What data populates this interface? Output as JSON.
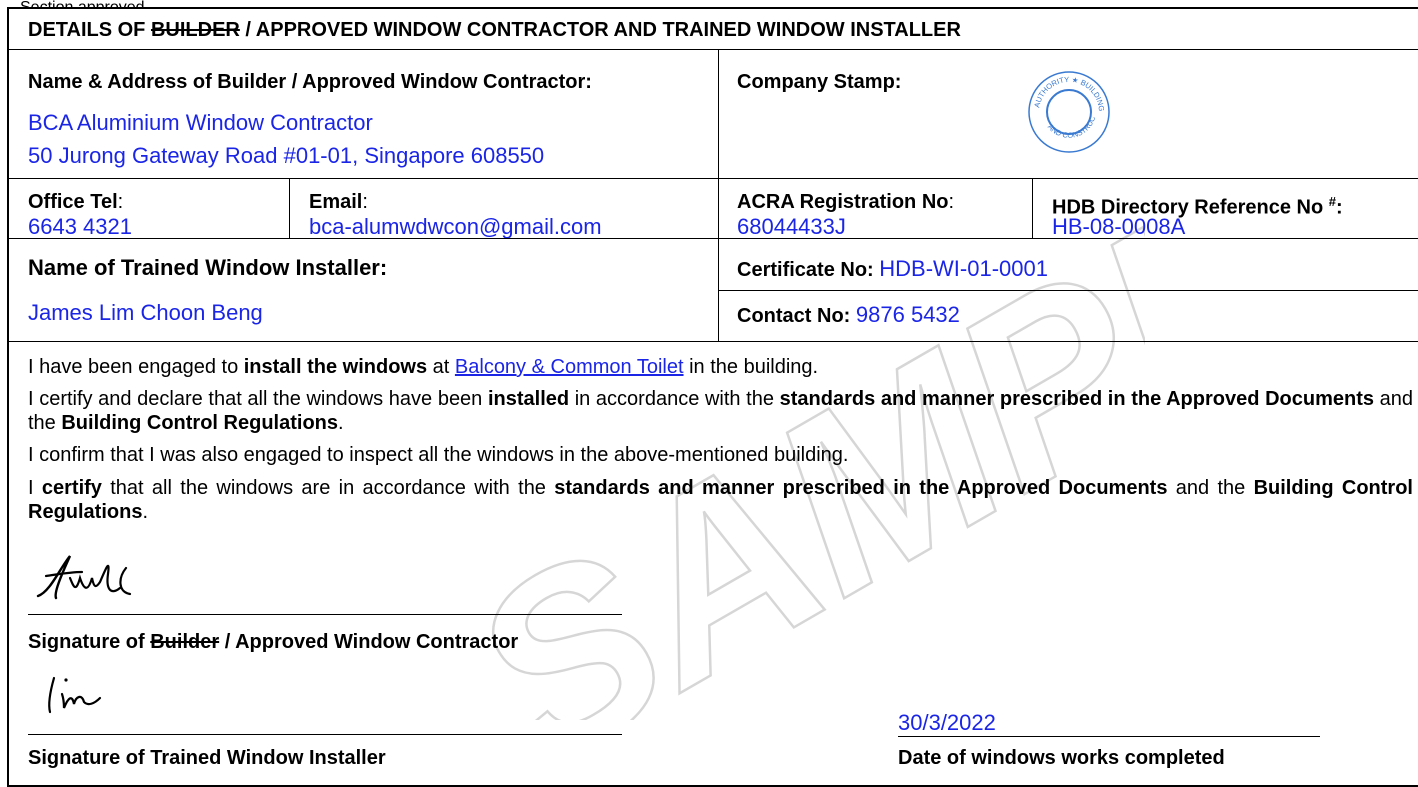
{
  "top_fragment": "Section approved",
  "header": {
    "prefix": "DETAILS OF ",
    "struck": "BUILDER",
    "suffix": " / APPROVED WINDOW CONTRACTOR AND TRAINED WINDOW INSTALLER"
  },
  "builder": {
    "label": "Name & Address of Builder / Approved Window Contractor:",
    "name": "BCA Aluminium Window Contractor",
    "address": "50 Jurong Gateway Road #01-01, Singapore 608550"
  },
  "stamp": {
    "label": "Company Stamp:",
    "text_top": "AUTHORITY ★ BUILDING",
    "text_bottom": "AND CONSTRUCTION"
  },
  "contacts": {
    "office_tel_label": "Office Tel",
    "office_tel": "6643 4321",
    "email_label": "Email",
    "email": "bca-alumwdwcon@gmail.com",
    "acra_label": "ACRA Registration No",
    "acra": "68044433J",
    "hdb_label": "HDB Directory Reference No ",
    "hdb_sup": "#",
    "hdb": "HB-08-0008A"
  },
  "installer": {
    "label": "Name of Trained Window Installer:",
    "name": "James Lim Choon Beng",
    "cert_label": "Certificate No",
    "cert": "HDB-WI-01-0001",
    "contact_label": "Contact No",
    "contact": "9876 5432"
  },
  "statements": {
    "s1a": "I have been engaged to ",
    "s1b": "install the windows",
    "s1c": " at ",
    "s1link": "Balcony & Common Toilet",
    "s1d": " in the building.",
    "s2a": "I certify and declare that all the windows have been ",
    "s2b": "installed",
    "s2c": " in accordance with the ",
    "s2d": "standards and manner prescribed in the Approved Documents",
    "s2e": " and the ",
    "s2f": "Building Control Regulations",
    "s2g": ".",
    "s3": "I confirm that I was also engaged to inspect all the windows in the above-mentioned building.",
    "s4a": "I ",
    "s4b": "certify",
    "s4c": " that all the windows are in accordance with the ",
    "s4d": "standards and manner prescribed in the Approved Documents",
    "s4e": " and the ",
    "s4f": "Building Control Regulations",
    "s4g": "."
  },
  "signatures": {
    "contractor_prefix": "Signature of ",
    "contractor_struck": "Builder",
    "contractor_suffix": " / Approved Window Contractor",
    "installer_label": "Signature of Trained Window Installer",
    "date": "30/3/2022",
    "date_label": "Date of windows works completed"
  },
  "watermark": "SAMPLE",
  "colors": {
    "field_blue": "#1a25e6",
    "watermark_gray": "#d9d9d9"
  }
}
